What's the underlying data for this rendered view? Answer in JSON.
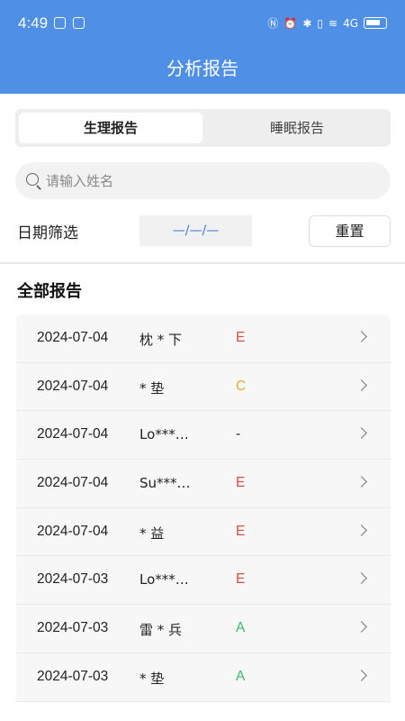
{
  "status_bar": {
    "time": "4:49",
    "network": "4G"
  },
  "header": {
    "title": "分析报告"
  },
  "tabs": [
    {
      "label": "生理报告",
      "active": true
    },
    {
      "label": "睡眠报告",
      "active": false
    }
  ],
  "search": {
    "placeholder": "请输入姓名",
    "value": ""
  },
  "filter": {
    "label": "日期筛选",
    "date_value": "—/—/—",
    "reset_label": "重置"
  },
  "section": {
    "title": "全部报告"
  },
  "reports": [
    {
      "date": "2024-07-04",
      "name": "枕 * 下",
      "grade": "E",
      "grade_color": "#d84a4a"
    },
    {
      "date": "2024-07-04",
      "name": "*     垫",
      "grade": "C",
      "grade_color": "#e0ad2a"
    },
    {
      "date": "2024-07-04",
      "name": "Lo***…",
      "grade": "-",
      "grade_color": "#222222"
    },
    {
      "date": "2024-07-04",
      "name": "Su***…",
      "grade": "E",
      "grade_color": "#d84a4a"
    },
    {
      "date": "2024-07-04",
      "name": "*     益",
      "grade": "E",
      "grade_color": "#d84a4a"
    },
    {
      "date": "2024-07-03",
      "name": "Lo***…",
      "grade": "E",
      "grade_color": "#d84a4a"
    },
    {
      "date": "2024-07-03",
      "name": "雷 * 兵",
      "grade": "A",
      "grade_color": "#3cb878"
    },
    {
      "date": "2024-07-03",
      "name": "*     垫",
      "grade": "A",
      "grade_color": "#3cb878"
    }
  ]
}
